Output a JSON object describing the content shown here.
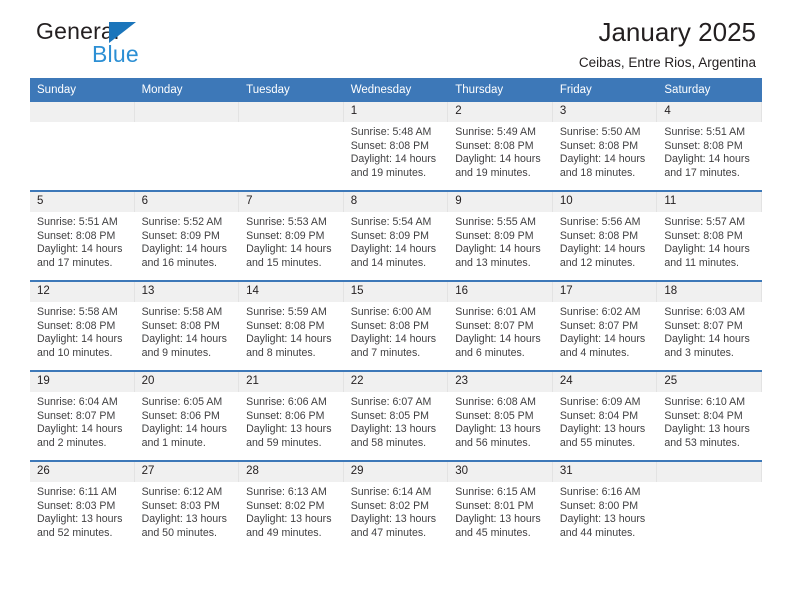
{
  "brand": {
    "name_top": "General",
    "name_bottom": "Blue",
    "triangle_color": "#1b75bb",
    "blue_text_color": "#2c8fd4"
  },
  "header": {
    "title": "January 2025",
    "subtitle": "Ceibas, Entre Rios, Argentina"
  },
  "colors": {
    "header_blue": "#3d78b8",
    "daynum_band": "#f0f0f0",
    "body_text": "#414042",
    "title_text": "#231f20"
  },
  "weekdays": [
    "Sunday",
    "Monday",
    "Tuesday",
    "Wednesday",
    "Thursday",
    "Friday",
    "Saturday"
  ],
  "labels": {
    "sunrise": "Sunrise:",
    "sunset": "Sunset:",
    "daylight": "Daylight:"
  },
  "weeks": [
    [
      {
        "day": "",
        "sunrise": "",
        "sunset": "",
        "daylight": ""
      },
      {
        "day": "",
        "sunrise": "",
        "sunset": "",
        "daylight": ""
      },
      {
        "day": "",
        "sunrise": "",
        "sunset": "",
        "daylight": ""
      },
      {
        "day": "1",
        "sunrise": "Sunrise: 5:48 AM",
        "sunset": "Sunset: 8:08 PM",
        "daylight": "Daylight: 14 hours and 19 minutes."
      },
      {
        "day": "2",
        "sunrise": "Sunrise: 5:49 AM",
        "sunset": "Sunset: 8:08 PM",
        "daylight": "Daylight: 14 hours and 19 minutes."
      },
      {
        "day": "3",
        "sunrise": "Sunrise: 5:50 AM",
        "sunset": "Sunset: 8:08 PM",
        "daylight": "Daylight: 14 hours and 18 minutes."
      },
      {
        "day": "4",
        "sunrise": "Sunrise: 5:51 AM",
        "sunset": "Sunset: 8:08 PM",
        "daylight": "Daylight: 14 hours and 17 minutes."
      }
    ],
    [
      {
        "day": "5",
        "sunrise": "Sunrise: 5:51 AM",
        "sunset": "Sunset: 8:08 PM",
        "daylight": "Daylight: 14 hours and 17 minutes."
      },
      {
        "day": "6",
        "sunrise": "Sunrise: 5:52 AM",
        "sunset": "Sunset: 8:09 PM",
        "daylight": "Daylight: 14 hours and 16 minutes."
      },
      {
        "day": "7",
        "sunrise": "Sunrise: 5:53 AM",
        "sunset": "Sunset: 8:09 PM",
        "daylight": "Daylight: 14 hours and 15 minutes."
      },
      {
        "day": "8",
        "sunrise": "Sunrise: 5:54 AM",
        "sunset": "Sunset: 8:09 PM",
        "daylight": "Daylight: 14 hours and 14 minutes."
      },
      {
        "day": "9",
        "sunrise": "Sunrise: 5:55 AM",
        "sunset": "Sunset: 8:09 PM",
        "daylight": "Daylight: 14 hours and 13 minutes."
      },
      {
        "day": "10",
        "sunrise": "Sunrise: 5:56 AM",
        "sunset": "Sunset: 8:08 PM",
        "daylight": "Daylight: 14 hours and 12 minutes."
      },
      {
        "day": "11",
        "sunrise": "Sunrise: 5:57 AM",
        "sunset": "Sunset: 8:08 PM",
        "daylight": "Daylight: 14 hours and 11 minutes."
      }
    ],
    [
      {
        "day": "12",
        "sunrise": "Sunrise: 5:58 AM",
        "sunset": "Sunset: 8:08 PM",
        "daylight": "Daylight: 14 hours and 10 minutes."
      },
      {
        "day": "13",
        "sunrise": "Sunrise: 5:58 AM",
        "sunset": "Sunset: 8:08 PM",
        "daylight": "Daylight: 14 hours and 9 minutes."
      },
      {
        "day": "14",
        "sunrise": "Sunrise: 5:59 AM",
        "sunset": "Sunset: 8:08 PM",
        "daylight": "Daylight: 14 hours and 8 minutes."
      },
      {
        "day": "15",
        "sunrise": "Sunrise: 6:00 AM",
        "sunset": "Sunset: 8:08 PM",
        "daylight": "Daylight: 14 hours and 7 minutes."
      },
      {
        "day": "16",
        "sunrise": "Sunrise: 6:01 AM",
        "sunset": "Sunset: 8:07 PM",
        "daylight": "Daylight: 14 hours and 6 minutes."
      },
      {
        "day": "17",
        "sunrise": "Sunrise: 6:02 AM",
        "sunset": "Sunset: 8:07 PM",
        "daylight": "Daylight: 14 hours and 4 minutes."
      },
      {
        "day": "18",
        "sunrise": "Sunrise: 6:03 AM",
        "sunset": "Sunset: 8:07 PM",
        "daylight": "Daylight: 14 hours and 3 minutes."
      }
    ],
    [
      {
        "day": "19",
        "sunrise": "Sunrise: 6:04 AM",
        "sunset": "Sunset: 8:07 PM",
        "daylight": "Daylight: 14 hours and 2 minutes."
      },
      {
        "day": "20",
        "sunrise": "Sunrise: 6:05 AM",
        "sunset": "Sunset: 8:06 PM",
        "daylight": "Daylight: 14 hours and 1 minute."
      },
      {
        "day": "21",
        "sunrise": "Sunrise: 6:06 AM",
        "sunset": "Sunset: 8:06 PM",
        "daylight": "Daylight: 13 hours and 59 minutes."
      },
      {
        "day": "22",
        "sunrise": "Sunrise: 6:07 AM",
        "sunset": "Sunset: 8:05 PM",
        "daylight": "Daylight: 13 hours and 58 minutes."
      },
      {
        "day": "23",
        "sunrise": "Sunrise: 6:08 AM",
        "sunset": "Sunset: 8:05 PM",
        "daylight": "Daylight: 13 hours and 56 minutes."
      },
      {
        "day": "24",
        "sunrise": "Sunrise: 6:09 AM",
        "sunset": "Sunset: 8:04 PM",
        "daylight": "Daylight: 13 hours and 55 minutes."
      },
      {
        "day": "25",
        "sunrise": "Sunrise: 6:10 AM",
        "sunset": "Sunset: 8:04 PM",
        "daylight": "Daylight: 13 hours and 53 minutes."
      }
    ],
    [
      {
        "day": "26",
        "sunrise": "Sunrise: 6:11 AM",
        "sunset": "Sunset: 8:03 PM",
        "daylight": "Daylight: 13 hours and 52 minutes."
      },
      {
        "day": "27",
        "sunrise": "Sunrise: 6:12 AM",
        "sunset": "Sunset: 8:03 PM",
        "daylight": "Daylight: 13 hours and 50 minutes."
      },
      {
        "day": "28",
        "sunrise": "Sunrise: 6:13 AM",
        "sunset": "Sunset: 8:02 PM",
        "daylight": "Daylight: 13 hours and 49 minutes."
      },
      {
        "day": "29",
        "sunrise": "Sunrise: 6:14 AM",
        "sunset": "Sunset: 8:02 PM",
        "daylight": "Daylight: 13 hours and 47 minutes."
      },
      {
        "day": "30",
        "sunrise": "Sunrise: 6:15 AM",
        "sunset": "Sunset: 8:01 PM",
        "daylight": "Daylight: 13 hours and 45 minutes."
      },
      {
        "day": "31",
        "sunrise": "Sunrise: 6:16 AM",
        "sunset": "Sunset: 8:00 PM",
        "daylight": "Daylight: 13 hours and 44 minutes."
      },
      {
        "day": "",
        "sunrise": "",
        "sunset": "",
        "daylight": ""
      }
    ]
  ]
}
